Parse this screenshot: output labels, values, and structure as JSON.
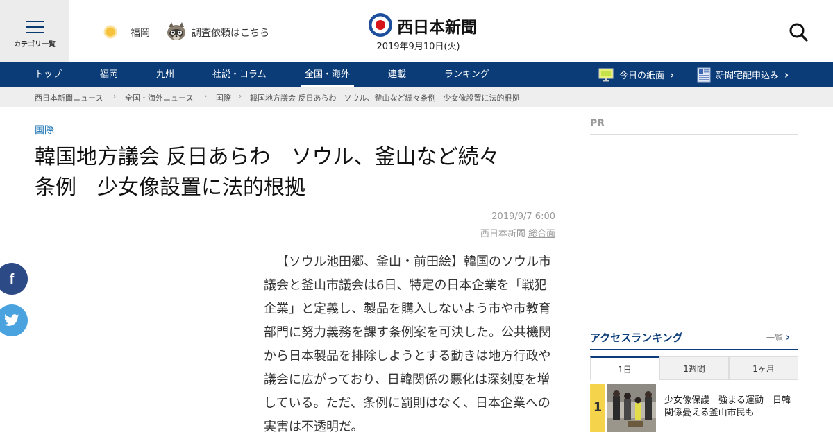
{
  "header": {
    "menu_label": "カテゴリ一覧",
    "weather_city": "福岡",
    "request_link": "調査依頼はこちら",
    "logo_text": "西日本新聞",
    "date": "2019年9月10日(火)"
  },
  "nav": {
    "items": [
      "トップ",
      "福岡",
      "九州",
      "社説・コラム",
      "全国・海外",
      "連載",
      "ランキング"
    ],
    "active_index": 4,
    "today_paper": "今日の紙面",
    "subscribe": "新聞宅配申込み"
  },
  "breadcrumb": [
    "西日本新聞ニュース",
    "全国・海外ニュース",
    "国際",
    "韓国地方議会 反日あらわ　ソウル、釜山など続々条例　少女像設置に法的根拠"
  ],
  "article": {
    "category": "国際",
    "title_line1": "韓国地方議会 反日あらわ　ソウル、釜山など続々",
    "title_line2": "条例　少女像設置に法的根拠",
    "date": "2019/9/7 6:00",
    "source": "西日本新聞",
    "source_link": "総合面",
    "body": "【ソウル池田郷、釜山・前田絵】韓国のソウル市議会と釜山市議会は6日、特定の日本企業を「戦犯企業」と定義し、製品を購入しないよう市や市教育部門に努力義務を課す条例案を可決した。公共機関から日本製品を排除しようとする動きは地方行政や議会に広がっており、日韓関係の悪化は深刻度を増している。ただ、条例に罰則はなく、日本企業への実害は不透明だ。"
  },
  "social": {
    "facebook": "f",
    "twitter": "twitter-icon"
  },
  "sidebar": {
    "pr_label": "PR",
    "ranking_title": "アクセスランキング",
    "ranking_more": "一覧",
    "tabs": [
      "1日",
      "1週間",
      "1ヶ月"
    ],
    "active_tab": 0,
    "items": [
      {
        "rank": "1",
        "headline": "少女像保護　強まる運動　日韓関係憂える釜山市民も"
      }
    ]
  },
  "colors": {
    "brand_navy": "#0b3c78",
    "category_blue": "#1a73b5",
    "rank_yellow": "#f5d44c",
    "facebook": "#2c4a86",
    "twitter": "#4aa3df"
  }
}
